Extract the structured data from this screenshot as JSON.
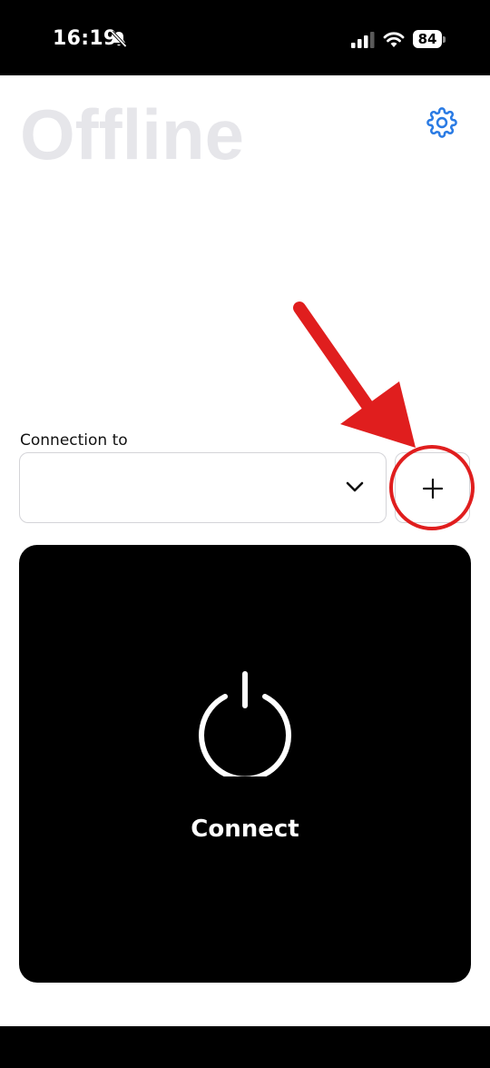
{
  "status_bar": {
    "time": "16:19",
    "battery": "84",
    "icons": [
      "bell-slash-icon",
      "cellular-signal-icon",
      "wifi-icon",
      "battery-icon"
    ]
  },
  "header": {
    "title": "Offline",
    "settings_icon": "gear-icon"
  },
  "connection": {
    "label": "Connection to",
    "selected": "",
    "dropdown_icon": "chevron-down-icon",
    "add_icon": "plus-icon"
  },
  "connect_card": {
    "label": "Connect",
    "icon": "power-icon"
  },
  "annotation": {
    "color": "#e01e1e"
  },
  "colors": {
    "accent": "#2a7be4",
    "title": "#e6e6ea",
    "card": "#000000"
  }
}
